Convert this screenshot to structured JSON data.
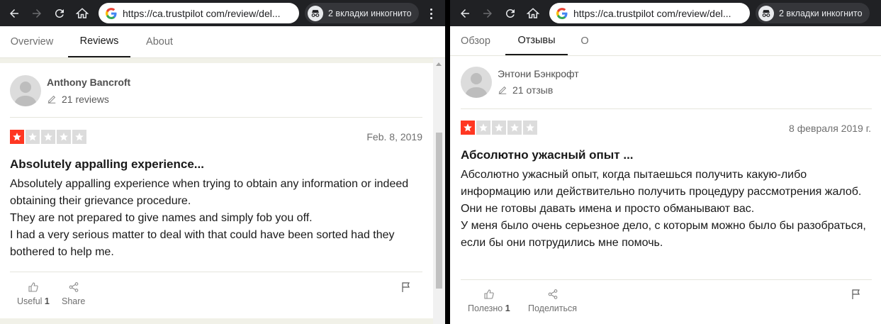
{
  "colors": {
    "toolbar_bg": "#202124",
    "star_red": "#ff3722",
    "star_grey": "#dcdcdc",
    "text_dark": "#191919",
    "text_muted": "#6f6f6f"
  },
  "left": {
    "browser": {
      "url": "https://ca.trustpilot com/review/del...",
      "incognito_label": "2 вкладки инкогнито"
    },
    "tabs": [
      "Overview",
      "Reviews",
      "About"
    ],
    "active_tab": "Reviews",
    "review": {
      "author": "Anthony Bancroft",
      "reviews_count": "21 reviews",
      "rating": 1,
      "date": "Feb. 8, 2019",
      "title": "Absolutely appalling experience...",
      "body": [
        "Absolutely appalling experience when trying to obtain any information or indeed obtaining their grievance procedure.",
        "They are not prepared to give names and simply fob you off.",
        "I had a very serious matter to deal with that could have been sorted had they bothered to help me."
      ],
      "useful_label": "Useful",
      "useful_count": "1",
      "share_label": "Share"
    }
  },
  "right": {
    "browser": {
      "url": "https://ca.trustpilot com/review/del...",
      "incognito_label": "2 вкладки инкогнито"
    },
    "tabs": [
      "Обзор",
      "Отзывы",
      "О"
    ],
    "active_tab": "Отзывы",
    "review": {
      "author": "Энтони Бэнкрофт",
      "reviews_count": "21 отзыв",
      "rating": 1,
      "date": "8 февраля 2019 г.",
      "title": "Абсолютно ужасный опыт ...",
      "body": [
        "Абсолютно ужасный опыт, когда пытаешься получить какую-либо информацию или действительно получить процедуру рассмотрения жалоб.",
        "Они не готовы давать имена и просто обманывают вас.",
        "У меня было очень серьезное дело, с которым можно было бы разобраться, если бы они потрудились мне помочь."
      ],
      "useful_label": "Полезно",
      "useful_count": "1",
      "share_label": "Поделиться"
    }
  }
}
